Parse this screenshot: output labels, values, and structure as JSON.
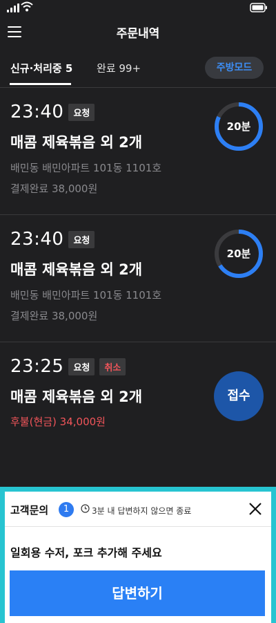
{
  "header": {
    "title": "주문내역"
  },
  "tabs": {
    "new": "신규·처리중 5",
    "done": "완료 99+",
    "kitchen_mode": "주방모드"
  },
  "orders": [
    {
      "time": "23:40",
      "badge": "요청",
      "menu": "매콤 제육볶음 외 2개",
      "address": "배민동 배민아파트 101동 1101호",
      "payment": "결제완료 38,000원",
      "timer_label": "20분",
      "timer_progress": 0.82
    },
    {
      "time": "23:40",
      "badge": "요청",
      "menu": "매콤 제육볶음 외 2개",
      "address": "배민동 배민아파트 101동 1101호",
      "payment": "결제완료 38,000원",
      "timer_label": "20분",
      "timer_progress": 0.66
    },
    {
      "time": "23:25",
      "badge": "요청",
      "badge_cancel": "취소",
      "menu": "매콤 제육볶음 외 2개",
      "payment": "후불(현금) 34,000원",
      "accept_label": "접수"
    }
  ],
  "inquiry": {
    "title": "고객문의",
    "count": "1",
    "notice": "3분 내 답변하지 않으면 종료",
    "message": "일회용 수저, 포크 추가해 주세요",
    "reply_label": "답변하기"
  },
  "colors": {
    "background": "#1f1f21",
    "accent_blue": "#2a80f5",
    "timer_blue": "#2d7ff4",
    "cancel_red": "#f2555a",
    "inquiry_border": "#27c4d1"
  }
}
